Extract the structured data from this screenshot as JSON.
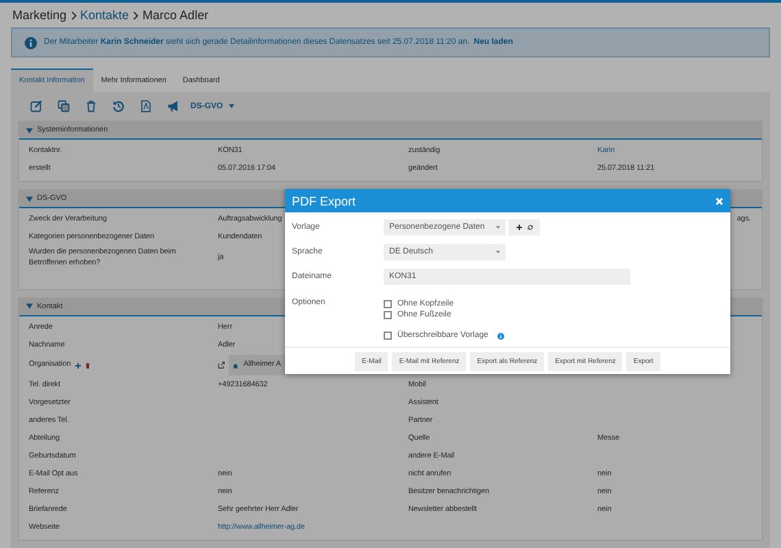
{
  "breadcrumb": [
    {
      "label": "Marketing",
      "link": false
    },
    {
      "label": "Kontakte",
      "link": true
    },
    {
      "label": "Marco Adler",
      "link": false
    }
  ],
  "notice": {
    "text": "Der Mitarbeiter **Karin Schneider** sieht sich gerade Detailinformationen dieses Datensatzes seit 25.07.2018 11:20 an.",
    "link": "Neu laden"
  },
  "tabs": [
    {
      "label": "Kontakt Information",
      "selected": true
    },
    {
      "label": "Mehr Informationen",
      "selected": false
    },
    {
      "label": "Dashboard",
      "selected": false
    }
  ],
  "toolbar": {
    "dropdown": "DS-GVO"
  },
  "sections": [
    {
      "title": "Systeminformationen",
      "expanded": true,
      "rows": [
        {
          "label": "Kontaktnr.",
          "value": "KON31",
          "right": {
            "label": "zuständig",
            "value": "Karin",
            "kind": "link"
          }
        },
        {
          "label": "erstellt",
          "value": "05.07.2016 17:04",
          "right": {
            "label": "geändert",
            "value": "25.07.2018 11:21"
          }
        }
      ]
    },
    {
      "title": "DS-GVO",
      "expanded": true,
      "rows": [
        {
          "label": "Zweck der Verarbeitung",
          "value": "Auftragsabwicklung",
          "right": {
            "value": "ags.",
            "kind": "cut"
          }
        },
        {
          "label": "Kategorien personenbezogener Daten",
          "value": "Kundendaten"
        },
        {
          "label": "Wurden die personenbezogenen Daten beim Betroffenen erhoben?",
          "value": "ja"
        }
      ]
    },
    {
      "title": "Kontakt",
      "expanded": true,
      "rows": [
        {
          "label": "Anrede",
          "value": "Herr"
        },
        {
          "label": "Nachname",
          "value": "Adler"
        },
        {
          "label": "Organisation",
          "value": "Allheimer A",
          "kind": "organisation"
        },
        {
          "label": "Tel. direkt",
          "value": "+49231684632",
          "right": {
            "label": "Mobil"
          }
        },
        {
          "label": "Vorgesetzter",
          "right": {
            "label": "Assistent"
          }
        },
        {
          "label": "anderes Tel.",
          "right": {
            "label": "Partner"
          }
        },
        {
          "label": "Abteilung",
          "right": {
            "label": "Quelle",
            "value": "Messe"
          }
        },
        {
          "label": "Geburtsdatum",
          "right": {
            "label": "andere E-Mail"
          }
        },
        {
          "label": "E-Mail Opt aus",
          "value": "nein",
          "right": {
            "label": "nicht anrufen",
            "value": "nein"
          }
        },
        {
          "label": "Referenz",
          "value": "nein",
          "right": {
            "label": "Besitzer benachrichtigen",
            "value": "nein"
          }
        },
        {
          "label": "Briefanrede",
          "value": "Sehr geehrter Herr Adler",
          "right": {
            "label": "Newsletter abbestellt",
            "value": "nein"
          }
        },
        {
          "label": "Webseite",
          "value": "http://www.allheimer-ag.de",
          "kind": "link"
        }
      ]
    }
  ],
  "modal": {
    "title": "PDF Export",
    "fields": [
      {
        "label": "Vorlage",
        "kind": "select",
        "value": "Personenbezogene Daten",
        "actions": true
      },
      {
        "label": "Sprache",
        "kind": "select",
        "value": "DE Deutsch",
        "actions": false
      },
      {
        "label": "Dateiname",
        "kind": "input",
        "value": "KON31",
        "actions": false
      },
      {
        "label": "Optionen",
        "kind": "options",
        "option_groups": [
          {
            "items": [
              {
                "label": "Ohne Kopfzeile",
                "checked": false,
                "info": false
              },
              {
                "label": "Ohne Fußzeile",
                "checked": false,
                "info": false
              }
            ]
          },
          {
            "items": [
              {
                "label": "Überschreibbare Vorlage",
                "checked": false,
                "info": true
              }
            ]
          }
        ]
      }
    ],
    "buttons": [
      "E-Mail",
      "E-Mail mit Referenz",
      "Export als Referenz",
      "Export mit Referenz",
      "Export"
    ]
  }
}
